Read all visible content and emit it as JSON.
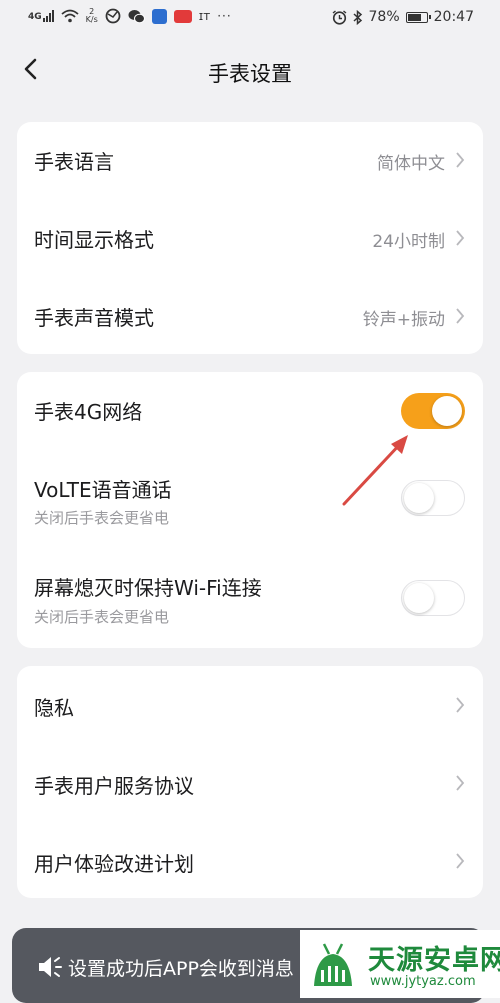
{
  "status_bar": {
    "network": "4G",
    "speed_value": "2",
    "speed_unit": "K/s",
    "battery_percent": "78%",
    "battery_level": 0.78,
    "time": "20:47",
    "icons": [
      "signal-icon",
      "wifi-icon",
      "browser-icon",
      "wechat-icon",
      "app-icon",
      "news-app-icon",
      "toutiao-icon",
      "more-icon",
      "alarm-icon",
      "bluetooth-icon",
      "battery-icon"
    ]
  },
  "header": {
    "title": "手表设置",
    "back_icon": "chevron-left-icon"
  },
  "group1": [
    {
      "label": "手表语言",
      "value": "简体中文"
    },
    {
      "label": "时间显示格式",
      "value": "24小时制"
    },
    {
      "label": "手表声音模式",
      "value": "铃声+振动"
    }
  ],
  "group2": [
    {
      "label": "手表4G网络",
      "sub": "",
      "on": true
    },
    {
      "label": "VoLTE语音通话",
      "sub": "关闭后手表会更省电",
      "on": false
    },
    {
      "label": "屏幕熄灭时保持Wi-Fi连接",
      "sub": "关闭后手表会更省电",
      "on": false
    }
  ],
  "group3": [
    {
      "label": "隐私"
    },
    {
      "label": "手表用户服务协议"
    },
    {
      "label": "用户体验改进计划"
    }
  ],
  "toast": {
    "text": "设置成功后APP会收到消息",
    "icon": "speaker-icon"
  },
  "watermark": {
    "name": "天源安卓网",
    "url": "www.jytyaz.com"
  },
  "colors": {
    "accent": "#f6a01a",
    "background": "#f1f1f3",
    "card": "#ffffff",
    "secondary_text": "#8e8e93",
    "annotation_arrow": "#d94a43",
    "watermark_green": "#1f8a3c"
  }
}
